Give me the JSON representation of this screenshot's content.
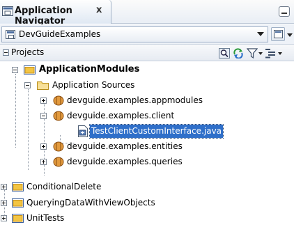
{
  "window": {
    "title": "Application Navigator",
    "close_glyph": "x",
    "minimize_icon": "minimize-icon"
  },
  "application_selector": {
    "selected": "DevGuideExamples",
    "icon": "application-icon",
    "menu_icon": "application-menu-icon"
  },
  "projects_panel": {
    "title": "Projects",
    "toolbar": [
      {
        "name": "filter-search-icon"
      },
      {
        "name": "refresh-icon"
      },
      {
        "name": "filter-funnel-icon"
      },
      {
        "name": "working-sets-icon"
      }
    ]
  },
  "tree": {
    "application_modules": "ApplicationModules",
    "application_sources": "Application Sources",
    "pkg_appmodules": "devguide.examples.appmodules",
    "pkg_client": "devguide.examples.client",
    "file_selected": "TestClientCustomInterface.java",
    "pkg_entities": "devguide.examples.entities",
    "pkg_queries": "devguide.examples.queries",
    "conditional_delete": "ConditionalDelete",
    "querying_data": "QueryingDataWithViewObjects",
    "unit_tests": "UnitTests"
  },
  "colors": {
    "selection": "#2f6fc9",
    "folder": "#f3c543",
    "package": "#b56a1c"
  }
}
